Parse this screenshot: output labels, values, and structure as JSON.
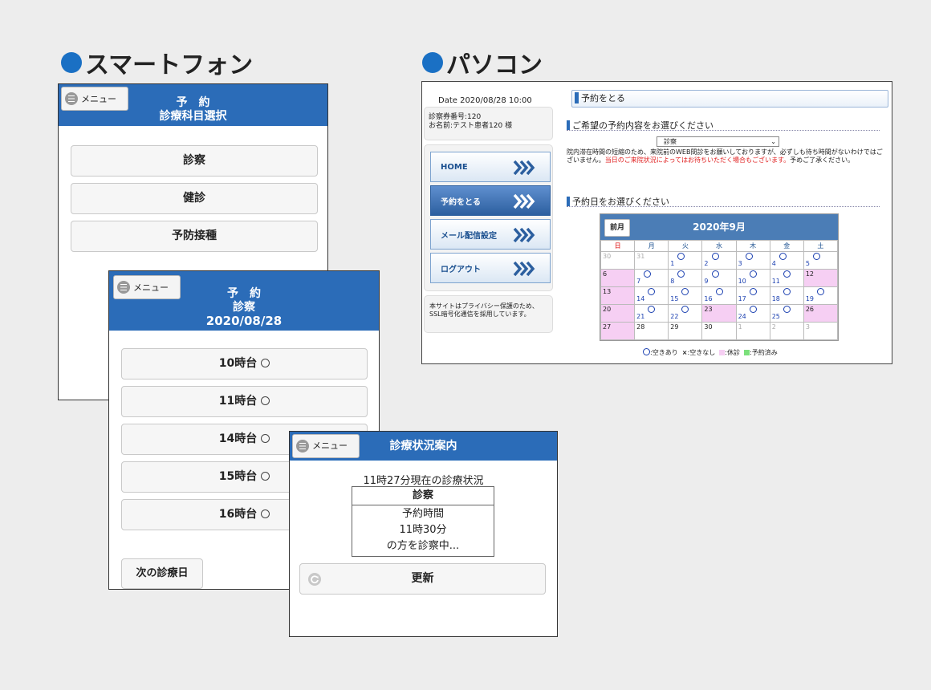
{
  "sections": {
    "smartphone_label": "スマートフォン",
    "pc_label": "パソコン"
  },
  "phone1": {
    "menu_label": "メニュー",
    "title_line1": "予　約",
    "title_line2": "診療科目選択",
    "buttons": [
      "診察",
      "健診",
      "予防接種"
    ]
  },
  "phone2": {
    "menu_label": "メニュー",
    "title_line1": "予　約",
    "title_line2": "診察",
    "title_line3": "2020/08/28",
    "slots": [
      "10時台",
      "11時台",
      "14時台",
      "15時台",
      "16時台"
    ],
    "next_label": "次の診療日"
  },
  "phone3": {
    "menu_label": "メニュー",
    "title": "診療状況案内",
    "status_caption": "11時27分現在の診療状況",
    "dept": "診察",
    "line1": "予約時間",
    "line2": "11時30分",
    "line3": "の方を診察中...",
    "refresh_label": "更新"
  },
  "pc": {
    "date": "Date 2020/08/28 10:00",
    "ticket": "診察券番号:120",
    "name": "お名前:テスト患者120 様",
    "nav": [
      "HOME",
      "予約をとる",
      "メール配信設定",
      "ログアウト"
    ],
    "privacy": "本サイトはプライバシー保護のため、SSL暗号化通信を採用しています。",
    "page_title": "予約をとる",
    "section1": "ご希望の予約内容をお選びください",
    "select_value": "診察",
    "note_black": "院内滞在時間の短縮のため、来院前のWEB問診をお願いしておりますが、必ずしも待ち時間がないわけではございません。",
    "note_red": "当日のご来院状況によってはお待ちいただく場合もございます。",
    "note_tail": "予めご了承ください。",
    "section2": "予約日をお選びください",
    "calendar": {
      "prev_label": "前月",
      "month": "2020年9月",
      "weekdays": [
        "日",
        "月",
        "火",
        "水",
        "木",
        "金",
        "土"
      ],
      "weeks": [
        [
          {
            "d": "30",
            "t": "other"
          },
          {
            "d": "31",
            "t": "other"
          },
          {
            "d": "1",
            "t": "avail"
          },
          {
            "d": "2",
            "t": "avail"
          },
          {
            "d": "3",
            "t": "avail"
          },
          {
            "d": "4",
            "t": "avail"
          },
          {
            "d": "5",
            "t": "avail"
          }
        ],
        [
          {
            "d": "6",
            "t": "closed"
          },
          {
            "d": "7",
            "t": "avail"
          },
          {
            "d": "8",
            "t": "avail"
          },
          {
            "d": "9",
            "t": "avail"
          },
          {
            "d": "10",
            "t": "avail"
          },
          {
            "d": "11",
            "t": "avail"
          },
          {
            "d": "12",
            "t": "closed"
          }
        ],
        [
          {
            "d": "13",
            "t": "closed"
          },
          {
            "d": "14",
            "t": "avail"
          },
          {
            "d": "15",
            "t": "avail"
          },
          {
            "d": "16",
            "t": "avail"
          },
          {
            "d": "17",
            "t": "avail"
          },
          {
            "d": "18",
            "t": "avail"
          },
          {
            "d": "19",
            "t": "avail"
          }
        ],
        [
          {
            "d": "20",
            "t": "closed"
          },
          {
            "d": "21",
            "t": "avail"
          },
          {
            "d": "22",
            "t": "avail"
          },
          {
            "d": "23",
            "t": "closed"
          },
          {
            "d": "24",
            "t": "avail"
          },
          {
            "d": "25",
            "t": "avail"
          },
          {
            "d": "26",
            "t": "closed"
          }
        ],
        [
          {
            "d": "27",
            "t": "closed"
          },
          {
            "d": "28",
            "t": "plain"
          },
          {
            "d": "29",
            "t": "plain"
          },
          {
            "d": "30",
            "t": "plain"
          },
          {
            "d": "1",
            "t": "other"
          },
          {
            "d": "2",
            "t": "other"
          },
          {
            "d": "3",
            "t": "other"
          }
        ]
      ]
    },
    "legend": {
      "available": ":空きあり",
      "full_mark": "×",
      "full": ":空きなし",
      "closed": ":休診",
      "booked": ":予約済み"
    }
  },
  "colors": {
    "bar_blue": "#2b6cb8",
    "dot_blue": "#1a70c4",
    "closed_pink": "#f6cff3",
    "booked_green": "#7be07b",
    "warning_red": "#e02020"
  }
}
